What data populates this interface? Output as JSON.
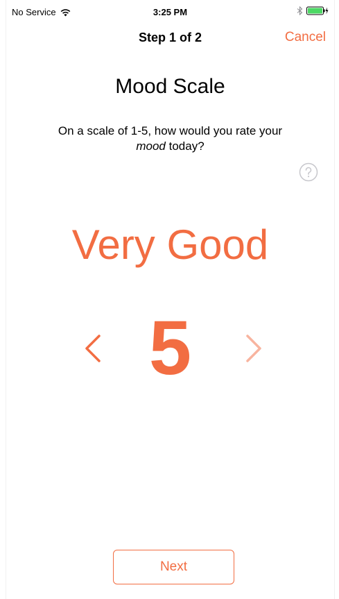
{
  "status_bar": {
    "carrier": "No Service",
    "time": "3:25 PM",
    "icons": [
      "wifi-icon",
      "bluetooth-icon",
      "battery-icon",
      "charging-bolt-icon"
    ]
  },
  "nav": {
    "title": "Step 1 of 2",
    "cancel_label": "Cancel"
  },
  "content": {
    "title": "Mood Scale",
    "question_prefix": "On a scale of 1-5, how would you rate your",
    "question_emphasis": "mood",
    "question_suffix": "today?",
    "help_icon": "question-circle-icon",
    "mood_label": "Very Good",
    "mood_value": "5",
    "prev_icon": "chevron-left-icon",
    "next_icon": "chevron-right-icon"
  },
  "footer": {
    "next_label": "Next"
  },
  "colors": {
    "accent": "#f26d42",
    "accent_disabled": "#f8b49f",
    "muted_icon": "#c7c7cc"
  }
}
